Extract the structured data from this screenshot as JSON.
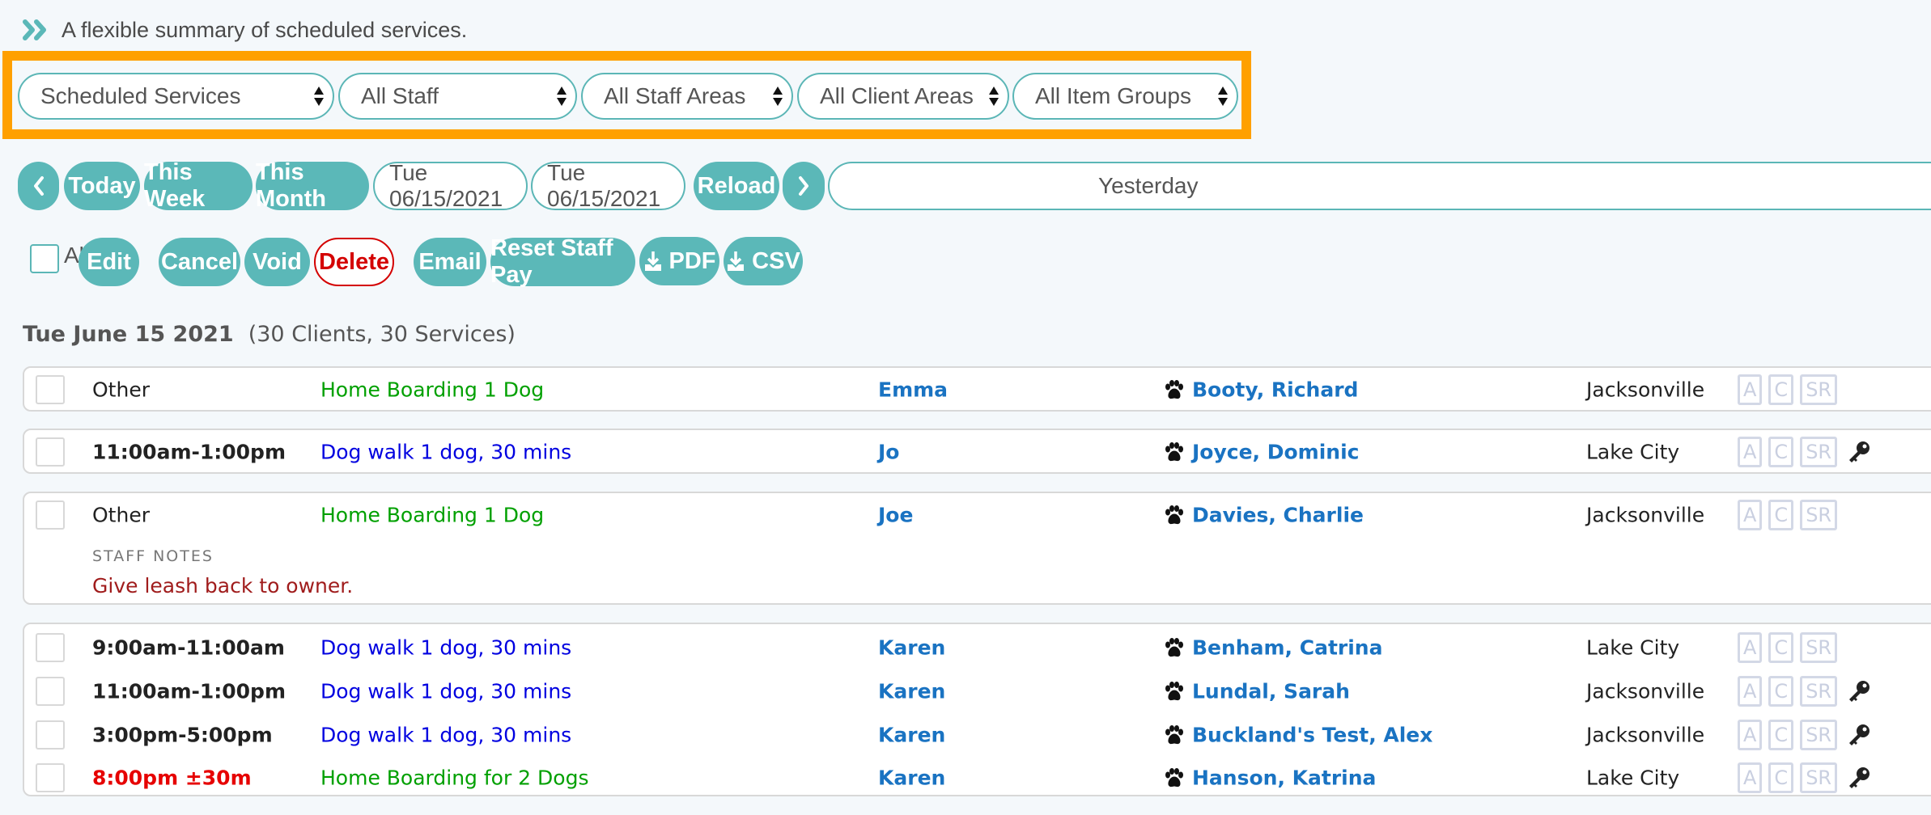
{
  "header": {
    "icon": "double-chevron-right-icon",
    "description": "A flexible summary of scheduled services."
  },
  "filters": {
    "highlight_color": "#ffa000",
    "selects": [
      {
        "name": "report-type-select",
        "value": "Scheduled Services"
      },
      {
        "name": "staff-select",
        "value": "All Staff"
      },
      {
        "name": "staff-areas-select",
        "value": "All Staff Areas"
      },
      {
        "name": "client-areas-select",
        "value": "All Client Areas"
      },
      {
        "name": "item-groups-select",
        "value": "All Item Groups"
      }
    ]
  },
  "date_nav": {
    "prev_icon": "chevron-left-icon",
    "today": "Today",
    "this_week": "This Week",
    "this_month": "This Month",
    "start_date": "Tue 06/15/2021",
    "end_date": "Tue 06/15/2021",
    "reload": "Reload",
    "next_icon": "chevron-right-icon",
    "range_label": "Yesterday"
  },
  "actions": {
    "select_all_label": "All",
    "edit": "Edit",
    "cancel": "Cancel",
    "void": "Void",
    "delete": "Delete",
    "email": "Email",
    "reset_staff_pay": "Reset Staff Pay",
    "pdf": "PDF",
    "csv": "CSV"
  },
  "colors": {
    "accent": "#5bb8b8",
    "danger": "#d40000",
    "link": "#1a73c2",
    "service_boarding": "#00a000",
    "service_walk": "#0000e0",
    "late_time": "#e60000",
    "notes_text": "#a01c1c"
  },
  "day": {
    "date_label": "Tue June 15 2021",
    "summary": "(30 Clients, 30 Services)"
  },
  "groups": [
    {
      "rows": [
        {
          "time": "Other",
          "time_style": "normal",
          "service": "Home Boarding 1 Dog",
          "service_type": "boarding",
          "staff": "Emma",
          "client": "Booty, Richard",
          "city": "Jacksonville",
          "badges": [
            "A",
            "C",
            "SR"
          ],
          "has_key": false
        }
      ]
    },
    {
      "rows": [
        {
          "time": "11:00am-1:00pm",
          "time_style": "bold",
          "service": "Dog walk 1 dog, 30 mins",
          "service_type": "walk",
          "staff": "Jo",
          "client": "Joyce, Dominic",
          "city": "Lake City",
          "badges": [
            "A",
            "C",
            "SR"
          ],
          "has_key": true
        }
      ]
    },
    {
      "rows": [
        {
          "time": "Other",
          "time_style": "normal",
          "service": "Home Boarding 1 Dog",
          "service_type": "boarding",
          "staff": "Joe",
          "client": "Davies, Charlie",
          "city": "Jacksonville",
          "badges": [
            "A",
            "C",
            "SR"
          ],
          "has_key": false
        }
      ],
      "notes_label": "STAFF NOTES",
      "notes": "Give leash back to owner."
    },
    {
      "rows": [
        {
          "time": "9:00am-11:00am",
          "time_style": "bold",
          "service": "Dog walk 1 dog, 30 mins",
          "service_type": "walk",
          "staff": "Karen",
          "client": "Benham, Catrina",
          "city": "Lake City",
          "badges": [
            "A",
            "C",
            "SR"
          ],
          "has_key": false
        },
        {
          "time": "11:00am-1:00pm",
          "time_style": "bold",
          "service": "Dog walk 1 dog, 30 mins",
          "service_type": "walk",
          "staff": "Karen",
          "client": "Lundal, Sarah",
          "city": "Jacksonville",
          "badges": [
            "A",
            "C",
            "SR"
          ],
          "has_key": true
        },
        {
          "time": "3:00pm-5:00pm",
          "time_style": "bold",
          "service": "Dog walk 1 dog, 30 mins",
          "service_type": "walk",
          "staff": "Karen",
          "client": "Buckland's Test, Alex",
          "city": "Jacksonville",
          "badges": [
            "A",
            "C",
            "SR"
          ],
          "has_key": true
        },
        {
          "time": "8:00pm ±30m",
          "time_style": "late",
          "service": "Home Boarding for 2 Dogs",
          "service_type": "boarding",
          "staff": "Karen",
          "client": "Hanson, Katrina",
          "city": "Lake City",
          "badges": [
            "A",
            "C",
            "SR"
          ],
          "has_key": true
        }
      ]
    }
  ]
}
